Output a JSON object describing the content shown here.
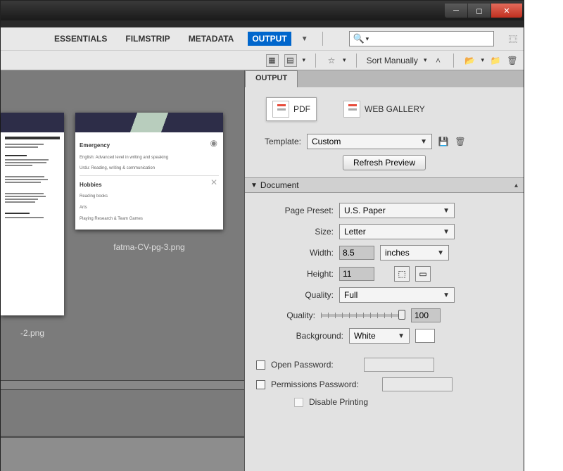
{
  "workspaces": {
    "essentials": "ESSENTIALS",
    "filmstrip": "FILMSTRIP",
    "metadata": "METADATA",
    "output": "OUTPUT"
  },
  "search": {
    "placeholder": ""
  },
  "toolbar": {
    "sort_label": "Sort Manually"
  },
  "thumbnails": {
    "file1_label": "-2.png",
    "file2_label": "fatma-CV-pg-3.png"
  },
  "panel": {
    "tab": "OUTPUT",
    "pdf": "PDF",
    "webgallery": "WEB GALLERY",
    "template_label": "Template:",
    "template_value": "Custom",
    "refresh": "Refresh Preview",
    "document_header": "Document",
    "page_preset_label": "Page Preset:",
    "page_preset_value": "U.S. Paper",
    "size_label": "Size:",
    "size_value": "Letter",
    "width_label": "Width:",
    "width_value": "8.5",
    "width_unit": "inches",
    "height_label": "Height:",
    "height_value": "11",
    "quality_label": "Quality:",
    "quality_value": "Full",
    "quality_slider_label": "Quality:",
    "quality_num": "100",
    "background_label": "Background:",
    "background_value": "White",
    "open_pw_label": "Open Password:",
    "perm_pw_label": "Permissions Password:",
    "disable_printing": "Disable Printing"
  }
}
